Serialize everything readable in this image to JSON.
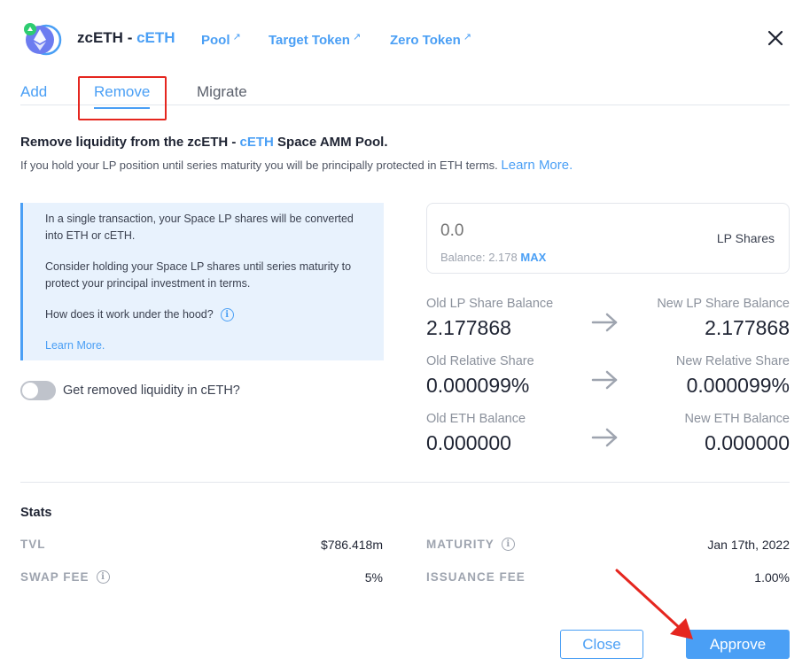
{
  "header": {
    "title_main": "zcETH",
    "title_sep": " - ",
    "title_accent": "cETH",
    "links": [
      {
        "label": "Pool",
        "arrow": "↗"
      },
      {
        "label": "Target Token",
        "arrow": "↗"
      },
      {
        "label": "Zero Token",
        "arrow": "↗"
      }
    ]
  },
  "tabs": [
    "Add",
    "Remove",
    "Migrate"
  ],
  "active_tab": "Remove",
  "intro": {
    "prefix": "Remove liquidity from the zcETH - ",
    "accent": "cETH",
    "suffix": " Space AMM Pool.",
    "subtitle": "If you hold your LP position until series maturity you will be principally protected in ETH terms.",
    "learn_more": "Learn More."
  },
  "info": {
    "para1": "In a single transaction, your Space LP shares will be converted into ETH or cETH.",
    "para2": "Consider holding your Space LP shares until series maturity to protect your principal investment in terms.",
    "hood": "How does it work under the hood?",
    "learn_more": "Learn More."
  },
  "toggle": {
    "label": "Get removed liquidity in cETH?",
    "on": false
  },
  "lp_input": {
    "placeholder": "0.0",
    "balance_label": "Balance: 2.178",
    "max_label": "MAX",
    "unit": "LP Shares"
  },
  "balances": [
    {
      "old_label": "Old LP Share Balance",
      "old_value": "2.177868",
      "new_label": "New LP Share Balance",
      "new_value": "2.177868"
    },
    {
      "old_label": "Old Relative Share",
      "old_value": "0.000099%",
      "new_label": "New Relative Share",
      "new_value": "0.000099%"
    },
    {
      "old_label": "Old ETH Balance",
      "old_value": "0.000000",
      "new_label": "New ETH Balance",
      "new_value": "0.000000"
    }
  ],
  "stats": {
    "title": "Stats",
    "tvl_label": "TVL",
    "tvl_value": "$786.418m",
    "maturity_label": "MATURITY",
    "maturity_value": "Jan 17th, 2022",
    "swap_fee_label": "SWAP FEE",
    "swap_fee_value": "5%",
    "issuance_fee_label": "ISSUANCE FEE",
    "issuance_fee_value": "1.00%"
  },
  "buttons": {
    "close": "Close",
    "approve": "Approve"
  },
  "colors": {
    "accent": "#4a9ff5",
    "annotation": "#e5261f",
    "info_bg": "#e8f2fd"
  },
  "icons": [
    "ethereum-logo-icon",
    "external-link-icon",
    "close-icon",
    "info-icon",
    "arrow-right-icon"
  ]
}
